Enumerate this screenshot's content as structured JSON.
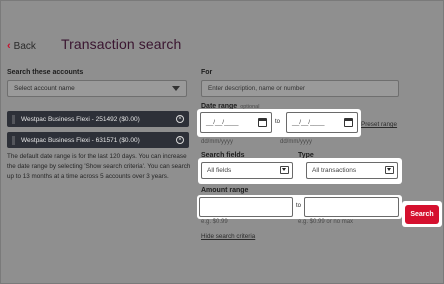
{
  "header": {
    "back_label": "Back",
    "title": "Transaction search"
  },
  "accounts": {
    "label": "Search these accounts",
    "select_placeholder": "Select account name",
    "items": [
      {
        "label": "Westpac Business Flexi - 251492 ($0.00)"
      },
      {
        "label": "Westpac Business Flexi - 631571 ($0.00)"
      }
    ],
    "help_text": "The default date range is for the last 120 days. You can increase the date range by selecting 'Show search criteria'. You can search up to 13 months at a time across 5 accounts over 3 years."
  },
  "for": {
    "label": "For",
    "placeholder": "Enter description, name or number"
  },
  "date_range": {
    "label": "Date range",
    "optional": "optional",
    "from_placeholder": "__/__/____",
    "to_word": "to",
    "to_placeholder": "__/__/____",
    "format_hint_1": "dd/mm/yyyy",
    "format_hint_2": "dd/mm/yyyy",
    "preset_link": "Preset range"
  },
  "search_fields": {
    "label": "Search fields",
    "value": "All fields"
  },
  "type": {
    "label": "Type",
    "value": "All transactions"
  },
  "amount_range": {
    "label": "Amount range",
    "to_word": "to",
    "hint_1": "e.g. $0.99",
    "hint_2": "e.g. $0.99 or no max"
  },
  "hide_link": "Hide search criteria",
  "search_button": "Search",
  "colors": {
    "accent": "#d5102e",
    "title": "#3a1530",
    "chip": "#2d3038"
  }
}
